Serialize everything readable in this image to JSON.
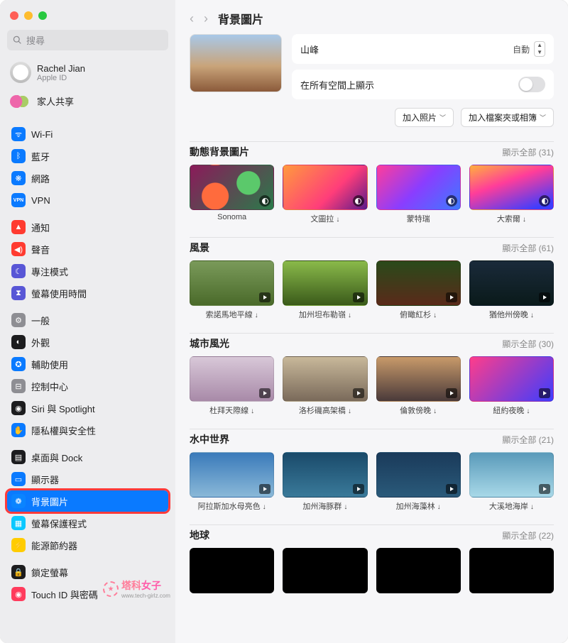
{
  "search": {
    "placeholder": "搜尋"
  },
  "account": {
    "name": "Rachel Jian",
    "sub": "Apple ID"
  },
  "family": {
    "label": "家人共享"
  },
  "nav": {
    "g1": [
      {
        "label": "Wi-Fi",
        "icon": "wifi",
        "color": "#0a7aff"
      },
      {
        "label": "藍牙",
        "icon": "bt",
        "color": "#0a7aff"
      },
      {
        "label": "網路",
        "icon": "globe",
        "color": "#0a7aff"
      },
      {
        "label": "VPN",
        "icon": "vpn",
        "color": "#0a7aff"
      }
    ],
    "g2": [
      {
        "label": "通知",
        "icon": "bell",
        "color": "#ff3b30"
      },
      {
        "label": "聲音",
        "icon": "sound",
        "color": "#ff3b30"
      },
      {
        "label": "專注模式",
        "icon": "moon",
        "color": "#5856d6"
      },
      {
        "label": "螢幕使用時間",
        "icon": "hour",
        "color": "#5856d6"
      }
    ],
    "g3": [
      {
        "label": "一般",
        "icon": "gear",
        "color": "#8e8e93"
      },
      {
        "label": "外觀",
        "icon": "appear",
        "color": "#1c1c1e"
      },
      {
        "label": "輔助使用",
        "icon": "access",
        "color": "#0a7aff"
      },
      {
        "label": "控制中心",
        "icon": "cc",
        "color": "#8e8e93"
      },
      {
        "label": "Siri 與 Spotlight",
        "icon": "siri",
        "color": "#1c1c1e"
      },
      {
        "label": "隱私權與安全性",
        "icon": "hand",
        "color": "#0a7aff"
      }
    ],
    "g4": [
      {
        "label": "桌面與 Dock",
        "icon": "dock",
        "color": "#1c1c1e"
      },
      {
        "label": "顯示器",
        "icon": "display",
        "color": "#0a7aff"
      },
      {
        "label": "背景圖片",
        "icon": "wall",
        "color": "#0a84ff",
        "selected": true,
        "highlight": true
      },
      {
        "label": "螢幕保護程式",
        "icon": "saver",
        "color": "#0ac8ff"
      },
      {
        "label": "能源節約器",
        "icon": "energy",
        "color": "#ffcc00"
      }
    ],
    "g5": [
      {
        "label": "鎖定螢幕",
        "icon": "lock",
        "color": "#1c1c1e"
      },
      {
        "label": "Touch ID 與密碼",
        "icon": "touch",
        "color": "#ff3b5c"
      }
    ]
  },
  "header": {
    "title": "背景圖片"
  },
  "current": {
    "name": "山峰",
    "mode": "自動",
    "allspaces_label": "在所有空間上顯示"
  },
  "actions": {
    "add_photo": "加入照片",
    "add_folder": "加入檔案夾或相簿"
  },
  "sections": {
    "dynamic": {
      "title": "動態背景圖片",
      "show_all": "顯示全部",
      "count": "(31)",
      "items": [
        {
          "label": "Sonoma",
          "cls": "t-sonoma",
          "badge": "dyn"
        },
        {
          "label": "文圖拉",
          "cls": "t-ventura",
          "badge": "dyn",
          "dl": true
        },
        {
          "label": "蒙特瑞",
          "cls": "t-monterey",
          "badge": "dyn"
        },
        {
          "label": "大索爾",
          "cls": "t-bigsur",
          "badge": "dyn",
          "dl": true
        }
      ]
    },
    "landscape": {
      "title": "風景",
      "show_all": "顯示全部",
      "count": "(61)",
      "items": [
        {
          "label": "索諾馬地平線",
          "cls": "t-land1",
          "badge": "play",
          "dl": true
        },
        {
          "label": "加州坦布勒嶺",
          "cls": "t-land2",
          "badge": "play",
          "dl": true
        },
        {
          "label": "俯瞰紅杉",
          "cls": "t-land3",
          "badge": "play",
          "dl": true
        },
        {
          "label": "猶他州傍晚",
          "cls": "t-land4",
          "badge": "play",
          "dl": true
        }
      ]
    },
    "city": {
      "title": "城市風光",
      "show_all": "顯示全部",
      "count": "(30)",
      "items": [
        {
          "label": "杜拜天際線",
          "cls": "t-city1",
          "badge": "play",
          "dl": true
        },
        {
          "label": "洛杉磯高架橋",
          "cls": "t-city2",
          "badge": "play",
          "dl": true
        },
        {
          "label": "倫敦傍晚",
          "cls": "t-city3",
          "badge": "play",
          "dl": true
        },
        {
          "label": "紐約夜晚",
          "cls": "t-city4",
          "badge": "play",
          "dl": true
        }
      ]
    },
    "sea": {
      "title": "水中世界",
      "show_all": "顯示全部",
      "count": "(21)",
      "items": [
        {
          "label": "阿拉斯加水母亮色",
          "cls": "t-sea1",
          "badge": "play",
          "dl": true
        },
        {
          "label": "加州海豚群",
          "cls": "t-sea2",
          "badge": "play",
          "dl": true
        },
        {
          "label": "加州海藻林",
          "cls": "t-sea3",
          "badge": "play",
          "dl": true
        },
        {
          "label": "大溪地海岸",
          "cls": "t-sea4",
          "badge": "play",
          "dl": true
        }
      ]
    },
    "earth": {
      "title": "地球",
      "show_all": "顯示全部",
      "count": "(22)",
      "items": [
        {
          "label": "",
          "cls": "t-earth"
        },
        {
          "label": "",
          "cls": "t-earth"
        },
        {
          "label": "",
          "cls": "t-earth"
        },
        {
          "label": "",
          "cls": "t-earth"
        }
      ]
    }
  },
  "watermark": {
    "t1": "塔科",
    "t2": "女子",
    "sub": "www.tech-girlz.com"
  }
}
